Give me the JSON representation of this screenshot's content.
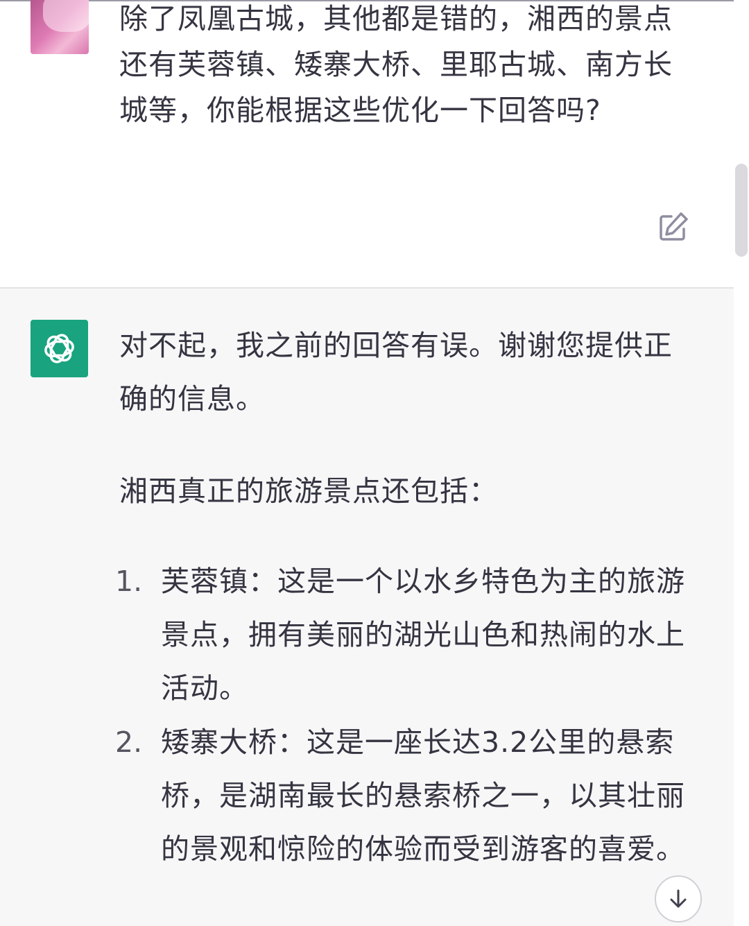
{
  "user_message": {
    "avatar_icon": "user-avatar-blurred",
    "text": "除了凤凰古城，其他都是错的，湘西的景点还有芙蓉镇、矮寨大桥、里耶古城、南方长城等，你能根据这些优化一下回答吗?",
    "edit_icon": "edit-icon"
  },
  "assistant_message": {
    "avatar_icon": "openai-logo-icon",
    "intro": "对不起，我之前的回答有误。谢谢您提供正确的信息。",
    "lead": "湘西真正的旅游景点还包括：",
    "items": [
      {
        "number": "1.",
        "text": "芙蓉镇：这是一个以水乡特色为主的旅游景点，拥有美丽的湖光山色和热闹的水上活动。"
      },
      {
        "number": "2.",
        "text": "矮寨大桥：这是一座长达3.2公里的悬索桥，是湖南最长的悬索桥之一，以其壮丽的景观和惊险的体验而受到游客的喜爱。"
      }
    ]
  },
  "controls": {
    "scroll_down_icon": "arrow-down-icon"
  },
  "colors": {
    "assistant_bg": "#f7f7f8",
    "assistant_avatar": "#19a37f",
    "text": "#343541"
  }
}
